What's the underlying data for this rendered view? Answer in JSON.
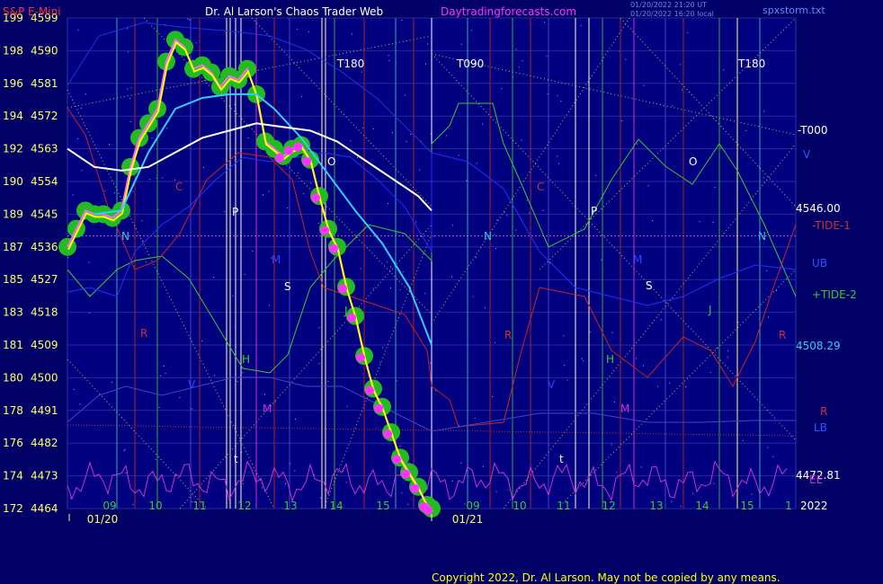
{
  "header": {
    "symbol": "S&P E-Mini",
    "author": "Dr. Al Larson's Chaos Trader Web",
    "site": "Daytradingforecasts.com",
    "stamp1": "01/20/2022 21:20 UT",
    "stamp2": "01/20/2022 16:20 local",
    "file": "spxstorm.txt"
  },
  "copyright": "Copyright 2022, Dr. Al Larson. May not be copied by any means.",
  "colors": {
    "background": "#000066",
    "plot_bg": "#000080",
    "price_glow": "#22bb22",
    "price_line": "#ffff00",
    "ma_cyan": "#33ccff",
    "ma_white": "#ffffff",
    "magenta_dots": "#ff33ff",
    "tide_green": "#33cc33",
    "tide_red": "#cc2222",
    "bands_blue": "#2233ff",
    "ee_magenta": "#cc33cc"
  },
  "chart_data": {
    "type": "line",
    "title": "S&P E-Mini",
    "ylim_price": [
      4464,
      4599
    ],
    "left_axis_a": [
      "199",
      "198",
      "196",
      "194",
      "192",
      "190",
      "189",
      "187",
      "185",
      "183",
      "181",
      "180",
      "178",
      "176",
      "174",
      "172"
    ],
    "left_axis_b": [
      "4599",
      "4590",
      "4581",
      "4572",
      "4563",
      "4554",
      "4545",
      "4536",
      "4527",
      "4518",
      "4509",
      "4500",
      "4491",
      "4482",
      "4473",
      "4464"
    ],
    "hour_ticks": [
      "09",
      "10",
      "11",
      "12",
      "13",
      "14",
      "15",
      "09",
      "10",
      "11",
      "12",
      "13",
      "14",
      "15",
      "1"
    ],
    "date_ticks": [
      "01/20",
      "01/21"
    ],
    "year_label": "2022",
    "right_values": [
      "4546.00",
      "4508.29",
      "4472.81"
    ],
    "right_labels": [
      "-T000",
      "V",
      "-TIDE-1",
      "UB",
      "+TIDE-2",
      "R",
      "LB",
      "EE"
    ],
    "time_markers": [
      "T180",
      "T090",
      "T180"
    ],
    "letter_marks": [
      "N",
      "C",
      "P",
      "M",
      "S",
      "J",
      "H",
      "V",
      "R",
      "O",
      "t",
      "M",
      "N",
      "C",
      "P",
      "M",
      "S",
      "J",
      "H",
      "V",
      "R",
      "O",
      "t",
      "M",
      "N",
      "R"
    ],
    "series": [
      {
        "name": "price",
        "x": [
          0,
          10,
          20,
          30,
          40,
          50,
          60,
          70,
          80,
          90,
          100,
          110,
          120,
          130,
          140,
          150,
          160,
          170,
          180,
          190,
          200,
          210,
          220,
          230,
          240,
          250,
          260,
          270,
          280,
          290,
          300,
          310,
          320,
          330,
          340,
          350,
          360,
          370,
          380,
          390,
          400,
          405
        ],
        "y": [
          4536,
          4541,
          4546,
          4545,
          4545,
          4544,
          4546,
          4558,
          4566,
          4570,
          4574,
          4587,
          4593,
          4591,
          4585,
          4586,
          4584,
          4580,
          4583,
          4582,
          4585,
          4578,
          4565,
          4563,
          4561,
          4563,
          4564,
          4560,
          4550,
          4541,
          4536,
          4525,
          4517,
          4506,
          4497,
          4492,
          4485,
          4478,
          4474,
          4470,
          4465,
          4464
        ]
      },
      {
        "name": "ma_cyan",
        "x": [
          30,
          60,
          90,
          120,
          150,
          180,
          210,
          230,
          260,
          290,
          320,
          350,
          380,
          405
        ],
        "y": [
          4545,
          4546,
          4562,
          4574,
          4577,
          4578,
          4578,
          4574,
          4566,
          4556,
          4546,
          4537,
          4525,
          4509
        ]
      },
      {
        "name": "ma_white",
        "x": [
          0,
          30,
          60,
          90,
          120,
          150,
          180,
          210,
          240,
          270,
          300,
          330,
          360,
          390,
          405
        ],
        "y": [
          4563,
          4558,
          4557,
          4558,
          4562,
          4566,
          4568,
          4570,
          4569,
          4568,
          4565,
          4560,
          4555,
          4550,
          4546
        ]
      },
      {
        "name": "ee",
        "x": [
          0,
          20,
          40,
          60,
          80,
          100,
          120,
          140,
          160,
          180,
          200,
          220,
          240,
          260,
          280,
          300,
          320,
          340,
          360,
          380,
          400
        ],
        "y": [
          4474,
          4471,
          4473,
          4468,
          4474,
          4470,
          4466,
          4478,
          4470,
          4474,
          4466,
          4476,
          4470,
          4474,
          4480,
          4470,
          4476,
          4470,
          4472,
          4469,
          4471
        ]
      }
    ],
    "grid": true
  }
}
